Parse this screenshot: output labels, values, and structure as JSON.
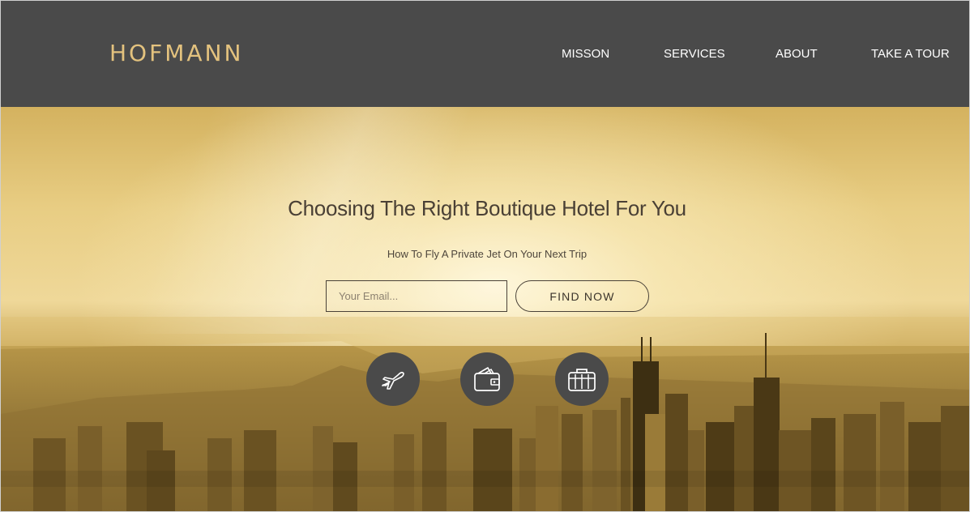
{
  "brand": {
    "logo": "HOFMANN",
    "accent_color": "#e3c27e"
  },
  "nav": {
    "items": [
      {
        "label": "MISSON"
      },
      {
        "label": "SERVICES"
      },
      {
        "label": "ABOUT"
      },
      {
        "label": "TAKE A TOUR"
      }
    ]
  },
  "hero": {
    "title": "Choosing The Right Boutique Hotel For You",
    "subtitle": "How To Fly A Private Jet On Your Next Trip",
    "email_placeholder": "Your Email...",
    "email_value": "",
    "cta_label": "FIND NOW",
    "features": [
      {
        "icon": "airplane-icon"
      },
      {
        "icon": "wallet-icon"
      },
      {
        "icon": "suitcase-icon"
      }
    ]
  },
  "colors": {
    "header_bg": "#4a4a4a",
    "icon_bg": "#4a4a4a",
    "hero_tint": "#d9b766"
  }
}
